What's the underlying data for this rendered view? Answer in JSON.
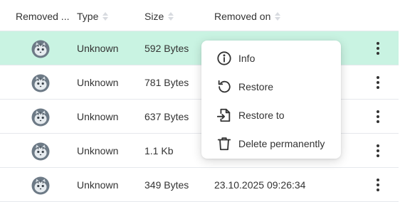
{
  "columns": {
    "removed_by": "Removed ...",
    "type": "Type",
    "size": "Size",
    "removed_on": "Removed on"
  },
  "rows": [
    {
      "type": "Unknown",
      "size": "592 Bytes",
      "removed_on": "",
      "selected": true
    },
    {
      "type": "Unknown",
      "size": "781 Bytes",
      "removed_on": "",
      "selected": false
    },
    {
      "type": "Unknown",
      "size": "637 Bytes",
      "removed_on": "",
      "selected": false
    },
    {
      "type": "Unknown",
      "size": "1.1 Kb",
      "removed_on": "",
      "selected": false
    },
    {
      "type": "Unknown",
      "size": "349 Bytes",
      "removed_on": "23.10.2025 09:26:34",
      "selected": false
    }
  ],
  "context_menu": {
    "items": [
      {
        "label": "Info",
        "icon": "info-icon"
      },
      {
        "label": "Restore",
        "icon": "restore-icon"
      },
      {
        "label": "Restore to",
        "icon": "restore-to-icon"
      },
      {
        "label": "Delete permanently",
        "icon": "trash-icon"
      }
    ]
  },
  "colors": {
    "selected_row": "#c9f3e2",
    "text": "#333333",
    "divider": "#e6e8ec"
  }
}
